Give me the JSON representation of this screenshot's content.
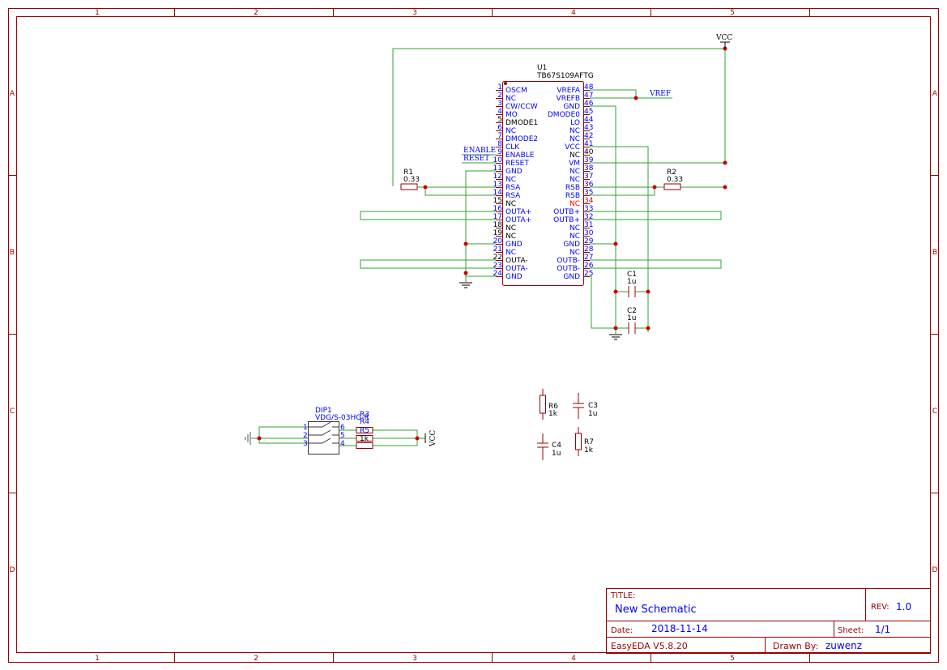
{
  "frame": {
    "columns": [
      "1",
      "2",
      "3",
      "4",
      "5"
    ],
    "rows": [
      "A",
      "B",
      "C",
      "D"
    ]
  },
  "ic": {
    "ref": "U1",
    "value": "TB67S109AFTG",
    "left_pins": [
      {
        "num": "1",
        "name": "OSCM",
        "color": "blue"
      },
      {
        "num": "2",
        "name": "NC",
        "color": "blue"
      },
      {
        "num": "3",
        "name": "CW/CCW",
        "color": "blue"
      },
      {
        "num": "4",
        "name": "MO",
        "color": "blue"
      },
      {
        "num": "5",
        "name": "DMODE1",
        "color": "black"
      },
      {
        "num": "6",
        "name": "NC",
        "color": "blue"
      },
      {
        "num": "7",
        "name": "DMODE2",
        "color": "blue"
      },
      {
        "num": "8",
        "name": "CLK",
        "color": "blue"
      },
      {
        "num": "9",
        "name": "ENABLE",
        "color": "blue"
      },
      {
        "num": "10",
        "name": "RESET",
        "color": "blue"
      },
      {
        "num": "11",
        "name": "GND",
        "color": "blue"
      },
      {
        "num": "12",
        "name": "NC",
        "color": "blue"
      },
      {
        "num": "13",
        "name": "RSA",
        "color": "blue"
      },
      {
        "num": "14",
        "name": "RSA",
        "color": "blue"
      },
      {
        "num": "15",
        "name": "NC",
        "color": "black"
      },
      {
        "num": "16",
        "name": "OUTA+",
        "color": "blue"
      },
      {
        "num": "17",
        "name": "OUTA+",
        "color": "blue"
      },
      {
        "num": "18",
        "name": "NC",
        "color": "black"
      },
      {
        "num": "19",
        "name": "NC",
        "color": "black"
      },
      {
        "num": "20",
        "name": "GND",
        "color": "blue"
      },
      {
        "num": "21",
        "name": "NC",
        "color": "blue"
      },
      {
        "num": "22",
        "name": "OUTA-",
        "color": "black"
      },
      {
        "num": "23",
        "name": "OUTA-",
        "color": "blue"
      },
      {
        "num": "24",
        "name": "GND",
        "color": "blue"
      }
    ],
    "right_pins": [
      {
        "num": "48",
        "name": "VREFA",
        "color": "blue"
      },
      {
        "num": "47",
        "name": "VREFB",
        "color": "blue"
      },
      {
        "num": "46",
        "name": "GND",
        "color": "blue"
      },
      {
        "num": "45",
        "name": "DMODE0",
        "color": "blue"
      },
      {
        "num": "44",
        "name": "LO",
        "color": "blue"
      },
      {
        "num": "43",
        "name": "NC",
        "color": "blue"
      },
      {
        "num": "42",
        "name": "NC",
        "color": "blue"
      },
      {
        "num": "41",
        "name": "VCC",
        "color": "blue"
      },
      {
        "num": "40",
        "name": "NC",
        "color": "black"
      },
      {
        "num": "39",
        "name": "VM",
        "color": "blue"
      },
      {
        "num": "38",
        "name": "NC",
        "color": "blue"
      },
      {
        "num": "37",
        "name": "NC",
        "color": "blue"
      },
      {
        "num": "36",
        "name": "RSB",
        "color": "blue"
      },
      {
        "num": "35",
        "name": "RSB",
        "color": "blue"
      },
      {
        "num": "34",
        "name": "NC",
        "color": "red"
      },
      {
        "num": "33",
        "name": "OUTB+",
        "color": "blue"
      },
      {
        "num": "32",
        "name": "OUTB+",
        "color": "blue"
      },
      {
        "num": "31",
        "name": "NC",
        "color": "blue"
      },
      {
        "num": "30",
        "name": "NC",
        "color": "blue"
      },
      {
        "num": "29",
        "name": "GND",
        "color": "blue"
      },
      {
        "num": "28",
        "name": "NC",
        "color": "blue"
      },
      {
        "num": "27",
        "name": "OUTB-",
        "color": "blue"
      },
      {
        "num": "26",
        "name": "OUTB-",
        "color": "blue"
      },
      {
        "num": "25",
        "name": "GND",
        "color": "blue"
      }
    ]
  },
  "nets": {
    "vcc": "VCC",
    "vref": "VREF",
    "enable": "ENABLE",
    "reset": "RESET",
    "vcc2": "VCC"
  },
  "parts": {
    "r1": {
      "ref": "R1",
      "value": "0.33"
    },
    "r2": {
      "ref": "R2",
      "value": "0.33"
    },
    "c1": {
      "ref": "C1",
      "value": "1u"
    },
    "c2": {
      "ref": "C2",
      "value": "1u"
    },
    "c3": {
      "ref": "C3",
      "value": "1u"
    },
    "c4": {
      "ref": "C4",
      "value": "1u"
    },
    "r6": {
      "ref": "R6",
      "value": "1k"
    },
    "r7": {
      "ref": "R7",
      "value": "1k"
    },
    "dip1": {
      "ref": "DIP1",
      "value": "VDG/S-03HG-R",
      "pins_left": [
        "1",
        "2",
        "3"
      ],
      "pins_right": [
        "6",
        "5",
        "4"
      ]
    },
    "r3": {
      "ref": "R3",
      "value": "1k"
    },
    "r4": {
      "ref": "R4"
    },
    "r5": {
      "ref": "R5"
    }
  },
  "title_block": {
    "title_label": "TITLE:",
    "title": "New Schematic",
    "rev_label": "REV:",
    "rev": "1.0",
    "date_label": "Date:",
    "date": "2018-11-14",
    "sheet_label": "Sheet:",
    "sheet": "1/1",
    "software": "EasyEDA V5.8.20",
    "drawn_label": "Drawn By:",
    "drawn_by": "zuwenz"
  },
  "colors": {
    "frame": "#990000",
    "wire": "#33a033",
    "junction": "#cc0000",
    "pin_text": "#0000ff"
  }
}
